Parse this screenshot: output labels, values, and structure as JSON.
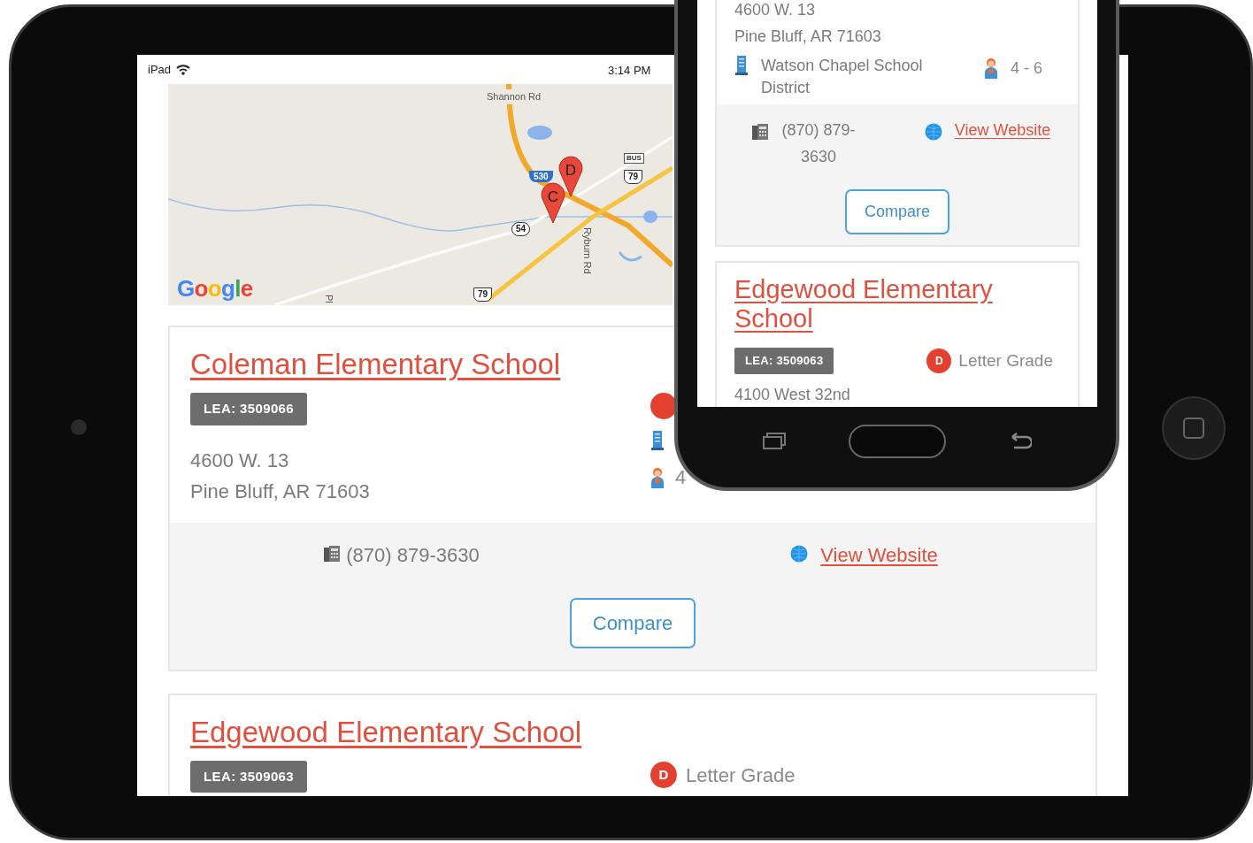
{
  "tablet": {
    "status_bar": {
      "device": "iPad",
      "time": "3:14 PM"
    },
    "map": {
      "labels": [
        {
          "text": "Shannon Rd",
          "kind": "road"
        },
        {
          "text": "Ryburn Rd",
          "kind": "road_vertical"
        },
        {
          "text": "Pl",
          "kind": "road_vertical"
        },
        {
          "text": "530",
          "kind": "shield_interstate"
        },
        {
          "text": "BUS",
          "kind": "plate"
        },
        {
          "text": "79",
          "kind": "shield_us"
        },
        {
          "text": "54",
          "kind": "shield_state"
        },
        {
          "text": "79",
          "kind": "shield_us"
        }
      ],
      "pins": [
        {
          "label": "D"
        },
        {
          "label": "C"
        }
      ],
      "logo": "Google"
    },
    "schools": [
      {
        "name": "Coleman Elementary School",
        "lea": "LEA: 3509066",
        "grade_badge": true,
        "address_lines": [
          "4600 W. 13",
          "Pine Bluff, AR 71603"
        ],
        "district_icon": true,
        "range": "4",
        "phone": "(870) 879-3630",
        "website": "View Website",
        "compare": "Compare"
      },
      {
        "name": "Edgewood Elementary School",
        "lea": "LEA: 3509063",
        "grade_badge": true,
        "grade": "D",
        "grade_label": "Letter Grade"
      }
    ]
  },
  "phone": {
    "schools": [
      {
        "address_lines": [
          "4600 W. 13",
          "Pine Bluff, AR 71603"
        ],
        "district": "Watson Chapel School District",
        "district_icon": true,
        "range": "4 - 6",
        "phone": "(870) 879-3630",
        "website": "View Website",
        "compare": "Compare"
      },
      {
        "name": "Edgewood Elementary School",
        "lea": "LEA: 3509063",
        "grade_badge": true,
        "grade": "D",
        "grade_label": "Letter Grade",
        "address_lines": [
          "4100 West 32nd"
        ]
      }
    ]
  }
}
